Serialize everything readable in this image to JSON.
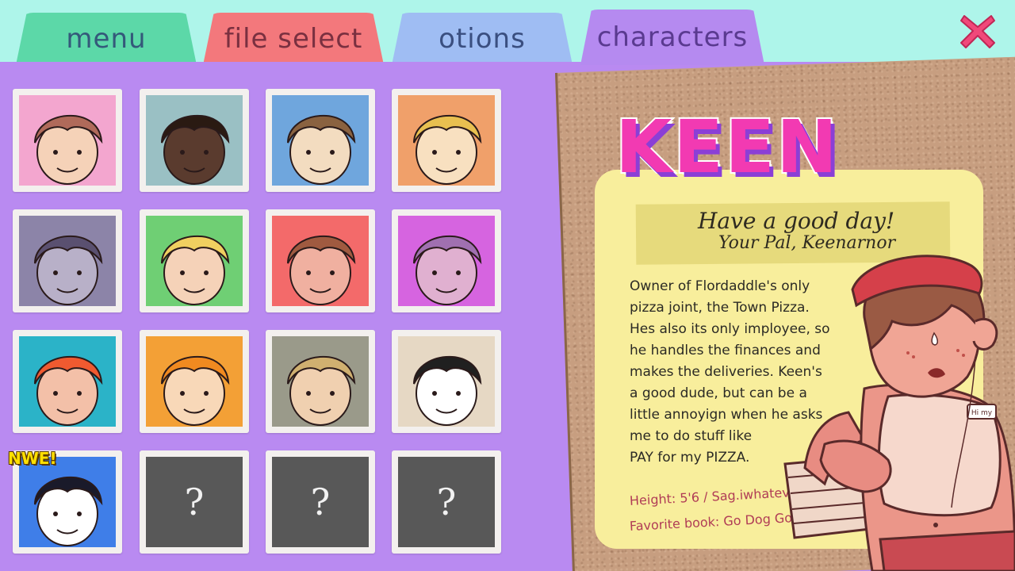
{
  "tabs": [
    {
      "label": "menu"
    },
    {
      "label": "file select"
    },
    {
      "label": "otions"
    },
    {
      "label": "characters"
    }
  ],
  "close_icon": "close-x-icon",
  "close_color": "#f0487a",
  "characters": [
    {
      "slot": 1,
      "bg": "#f3a6cf",
      "locked": false
    },
    {
      "slot": 2,
      "bg": "#9ac0c4",
      "locked": false
    },
    {
      "slot": 3,
      "bg": "#6fa6dd",
      "locked": false
    },
    {
      "slot": 4,
      "bg": "#f0a06a",
      "locked": false
    },
    {
      "slot": 5,
      "bg": "#8c84a8",
      "locked": false
    },
    {
      "slot": 6,
      "bg": "#6fcf74",
      "locked": false
    },
    {
      "slot": 7,
      "bg": "#f36a6a",
      "locked": false
    },
    {
      "slot": 8,
      "bg": "#d664e0",
      "locked": false
    },
    {
      "slot": 9,
      "bg": "#2bb3c8",
      "locked": false
    },
    {
      "slot": 10,
      "bg": "#f3a036",
      "locked": false
    },
    {
      "slot": 11,
      "bg": "#9a9a8a",
      "locked": false
    },
    {
      "slot": 12,
      "bg": "#e6d8c4",
      "locked": false
    },
    {
      "slot": 13,
      "bg": "#3f7ee8",
      "locked": false,
      "badge": "NWE!"
    },
    {
      "slot": 14,
      "locked": true,
      "label": "?"
    },
    {
      "slot": 15,
      "locked": true,
      "label": "?"
    },
    {
      "slot": 16,
      "locked": true,
      "label": "?"
    }
  ],
  "selected": {
    "name": "KEEN",
    "greeting_line1": "Have a good day!",
    "greeting_line2": "Your Pal, Keenarnor",
    "description": "Owner of Flordaddle's only\npizza joint, the Town Pizza.\nHes also its only imployee, so\nhe handles the finances and\nmakes the deliveries. Keen's\na good dude, but can be a\nlittle annoyign when he asks\nme to do stuff like\nPAY for my PIZZA.",
    "stat_height": "Height: 5'6 / Sag.iwhatever",
    "stat_book": "Favorite book: Go Dog Go",
    "name_tag": "Hi my"
  },
  "colors": {
    "background": "#aef5ea",
    "panel": "#b98af1",
    "name_fill": "#f23ab2",
    "name_shadow": "#8b3fd6"
  }
}
